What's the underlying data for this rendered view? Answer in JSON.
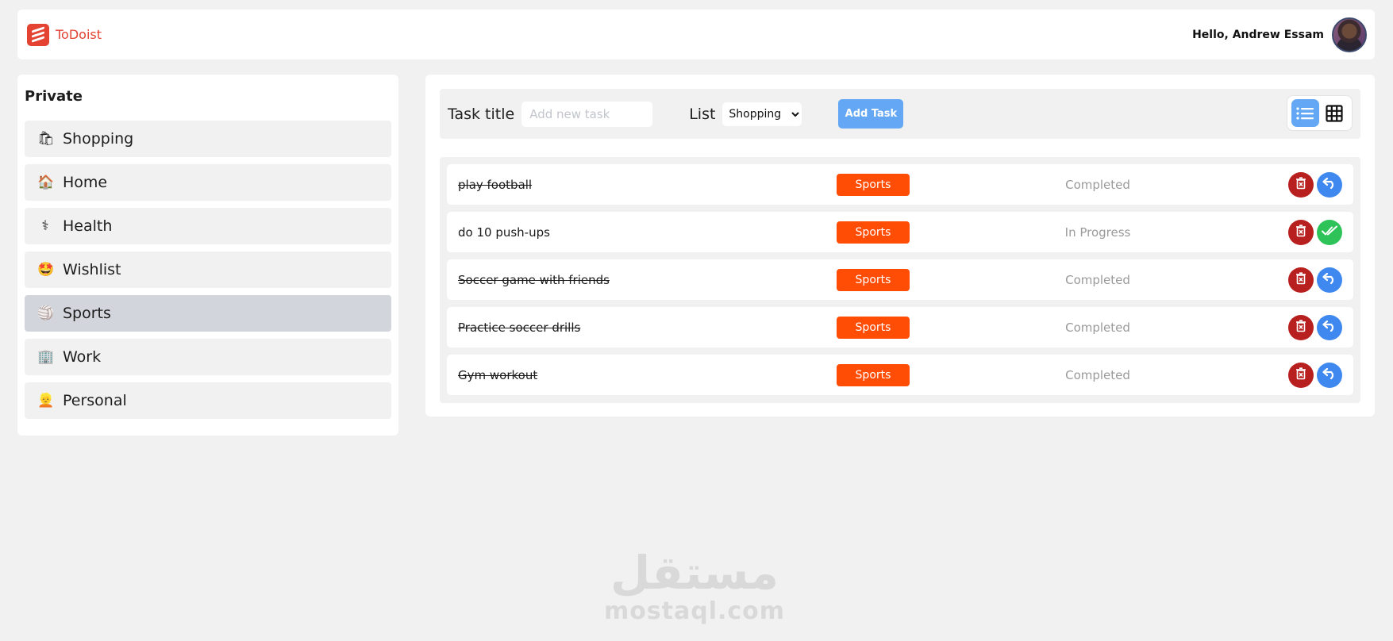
{
  "header": {
    "app_name": "ToDoist",
    "greeting": "Hello, Andrew Essam",
    "brand_color": "#e44332"
  },
  "sidebar": {
    "title": "Private",
    "items": [
      {
        "label": "Shopping",
        "icon": "shopping-bags-icon",
        "glyph": "🛍"
      },
      {
        "label": "Home",
        "icon": "house-icon",
        "glyph": "🏠"
      },
      {
        "label": "Health",
        "icon": "medical-staff-icon",
        "glyph": "⚕"
      },
      {
        "label": "Wishlist",
        "icon": "star-struck-face-icon",
        "glyph": "🤩"
      },
      {
        "label": "Sports",
        "icon": "volleyball-icon",
        "glyph": "🏐"
      },
      {
        "label": "Work",
        "icon": "office-building-icon",
        "glyph": "🏢"
      },
      {
        "label": "Personal",
        "icon": "person-icon",
        "glyph": "👱"
      }
    ],
    "active": "Sports"
  },
  "toolbar": {
    "task_title_label": "Task title",
    "task_input_value": "",
    "task_input_placeholder": "Add new task",
    "list_label": "List",
    "list_selected": "Shopping",
    "add_button_label": "Add Task",
    "view_mode": "list"
  },
  "tasks": [
    {
      "title": "play football",
      "tag": "Sports",
      "status": "Completed",
      "done": true
    },
    {
      "title": "do 10 push-ups",
      "tag": "Sports",
      "status": "In Progress",
      "done": false
    },
    {
      "title": "Soccer game with friends",
      "tag": "Sports",
      "status": "Completed",
      "done": true
    },
    {
      "title": "Practice soccer drills",
      "tag": "Sports",
      "status": "Completed",
      "done": true
    },
    {
      "title": "Gym workout",
      "tag": "Sports",
      "status": "Completed",
      "done": true
    }
  ],
  "colors": {
    "tag": "#ff4d06",
    "delete": "#b8201f",
    "undo": "#3f88f0",
    "complete": "#2ec359",
    "accent": "#64a8f5"
  },
  "watermark": {
    "arabic": "مستقل",
    "latin": "mostaql.com"
  }
}
